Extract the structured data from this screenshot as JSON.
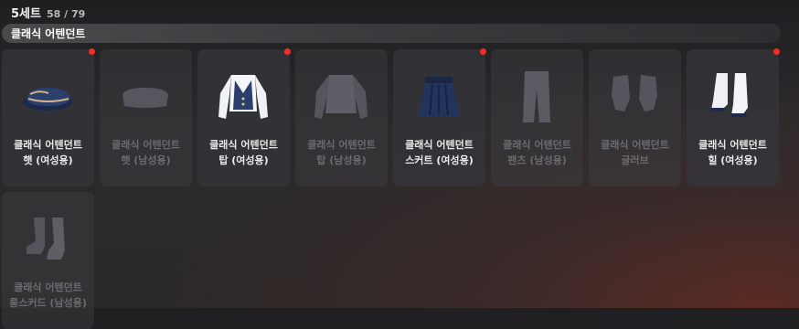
{
  "header": {
    "title": "5세트",
    "count": "58 / 79"
  },
  "set_name": "클래식 어텐던트",
  "items": [
    {
      "line1": "클래식 어텐던트",
      "line2": "햇 (여성용)",
      "owned": true,
      "new": true,
      "icon": "hat-icon"
    },
    {
      "line1": "클래식 어텐던트",
      "line2": "햇 (남성용)",
      "owned": false,
      "new": false,
      "icon": "cap-icon"
    },
    {
      "line1": "클래식 어텐던트",
      "line2": "탑 (여성용)",
      "owned": true,
      "new": true,
      "icon": "uniform-top-icon"
    },
    {
      "line1": "클래식 어텐던트",
      "line2": "탑 (남성용)",
      "owned": false,
      "new": false,
      "icon": "jacket-icon"
    },
    {
      "line1": "클래식 어텐던트",
      "line2": "스커트 (여성용)",
      "owned": true,
      "new": true,
      "icon": "skirt-icon"
    },
    {
      "line1": "클래식 어텐던트",
      "line2": "팬츠 (남성용)",
      "owned": false,
      "new": false,
      "icon": "pants-icon"
    },
    {
      "line1": "클래식 어텐던트",
      "line2": "글러브",
      "owned": false,
      "new": false,
      "icon": "gloves-icon"
    },
    {
      "line1": "클래식 어텐던트",
      "line2": "힐 (여성용)",
      "owned": true,
      "new": true,
      "icon": "heels-icon"
    },
    {
      "line1": "클래식 어텐던트",
      "line2": "롱스커드 (남성용)",
      "owned": false,
      "new": false,
      "icon": "boots-icon"
    }
  ],
  "colors": {
    "new_dot": "#ff2a1f",
    "locked_text": "#6a6a70",
    "owned_text": "#e9e9e9"
  }
}
